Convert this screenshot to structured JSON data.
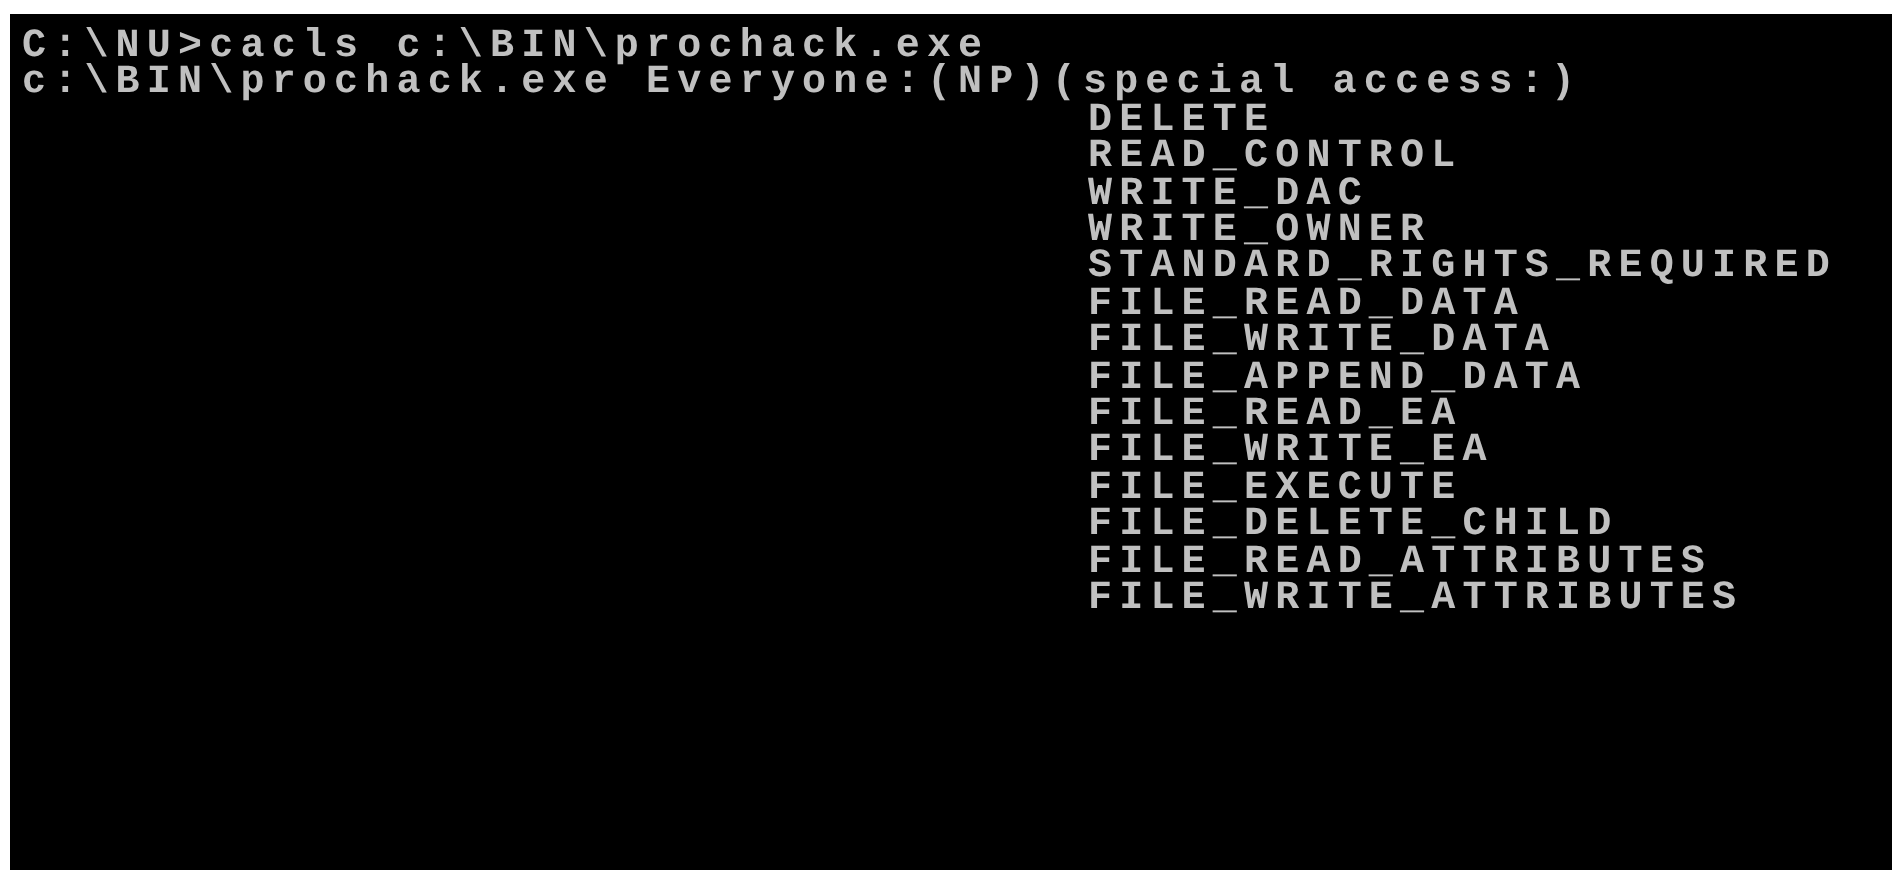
{
  "console": {
    "lines": [
      {
        "kind": "command",
        "text": "C:\\NU>cacls c:\\BIN\\prochack.exe"
      },
      {
        "kind": "output",
        "text": "c:\\BIN\\prochack.exe Everyone:(NP)(special access:)"
      },
      {
        "kind": "permission",
        "text": "DELETE"
      },
      {
        "kind": "permission",
        "text": "READ_CONTROL"
      },
      {
        "kind": "permission",
        "text": "WRITE_DAC"
      },
      {
        "kind": "permission",
        "text": "WRITE_OWNER"
      },
      {
        "kind": "permission",
        "text": "STANDARD_RIGHTS_REQUIRED"
      },
      {
        "kind": "permission",
        "text": "FILE_READ_DATA"
      },
      {
        "kind": "permission",
        "text": "FILE_WRITE_DATA"
      },
      {
        "kind": "permission",
        "text": "FILE_APPEND_DATA"
      },
      {
        "kind": "permission",
        "text": "FILE_READ_EA"
      },
      {
        "kind": "permission",
        "text": "FILE_WRITE_EA"
      },
      {
        "kind": "permission",
        "text": "FILE_EXECUTE"
      },
      {
        "kind": "permission",
        "text": "FILE_DELETE_CHILD"
      },
      {
        "kind": "permission",
        "text": "FILE_READ_ATTRIBUTES"
      },
      {
        "kind": "permission",
        "text": "FILE_WRITE_ATTRIBUTES"
      }
    ]
  }
}
